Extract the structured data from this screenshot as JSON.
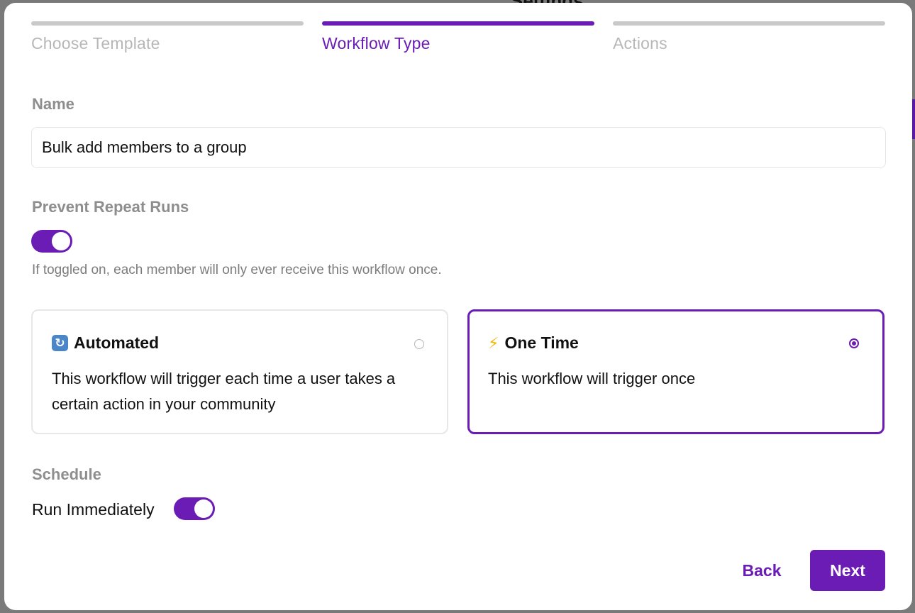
{
  "background": {
    "title": "Settings"
  },
  "stepper": {
    "steps": [
      {
        "label": "Choose Template",
        "state": "inactive"
      },
      {
        "label": "Workflow Type",
        "state": "active"
      },
      {
        "label": "Actions",
        "state": "inactive"
      }
    ]
  },
  "name_field": {
    "label": "Name",
    "value": "Bulk add members to a group"
  },
  "prevent_repeat": {
    "label": "Prevent Repeat Runs",
    "enabled": true,
    "helper": "If toggled on, each member will only ever receive this workflow once."
  },
  "workflow_types": [
    {
      "icon": "repeat-icon",
      "title": "Automated",
      "description": "This workflow will trigger each time a user takes a certain action in your community",
      "selected": false
    },
    {
      "icon": "lightning-icon",
      "title": "One Time",
      "description": "This workflow will trigger once",
      "selected": true
    }
  ],
  "schedule": {
    "label": "Schedule",
    "run_immediately_label": "Run Immediately",
    "run_immediately": true
  },
  "footer": {
    "back_label": "Back",
    "next_label": "Next"
  },
  "colors": {
    "accent": "#6a1cb5",
    "inactive_step": "#c9c9c9",
    "muted_label": "#8e8e8e"
  }
}
